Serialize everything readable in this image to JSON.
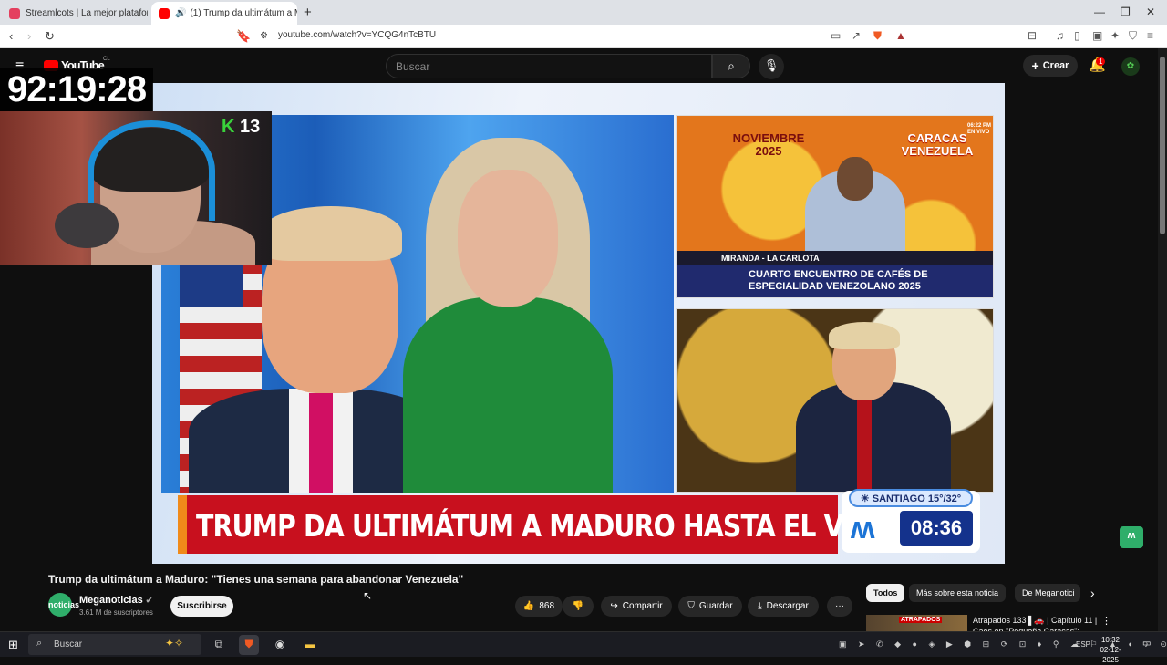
{
  "browser": {
    "tabs": [
      {
        "label": "Streamlcots | La mejor plataforma pa",
        "active": false,
        "favicon_color": "#e4405f"
      },
      {
        "label": "(1) Trump da ultimátum a Ma",
        "active": true,
        "favicon_color": "#ff0000"
      }
    ],
    "new_tab_symbol": "+",
    "url": "youtube.com/watch?v=YCQG4nTcBTU",
    "window_controls": {
      "minimize": "—",
      "maximize": "❐",
      "close": "✕"
    }
  },
  "youtube": {
    "logo": "YouTube",
    "country": "CL",
    "search_placeholder": "Buscar",
    "create_label": "Crear",
    "notifications_count": "1",
    "video": {
      "title": "Trump da ultimátum a Maduro: \"Tienes una semana para abandonar Venezuela\"",
      "channel": "Meganoticias",
      "channel_logo_text": "noticias",
      "subscribers": "3.61 M de suscriptores",
      "subscribe_label": "Suscribirse",
      "likes": "868",
      "share_label": "Compartir",
      "save_label": "Guardar",
      "download_label": "Descargar",
      "more_label": "···"
    },
    "chips": [
      {
        "label": "Todos",
        "selected": true
      },
      {
        "label": "Más sobre esta noticia",
        "selected": false
      },
      {
        "label": "De Meganotici",
        "selected": false
      }
    ],
    "suggested": {
      "thumb_text": "ATRAPADOS",
      "title": "Atrapados 133 ▌🚗 | Capítulo 11 | Caos en \"Pequeña Caracas\": ..."
    }
  },
  "broadcast": {
    "channel_bug": "13",
    "chyron": "TRUMP DA ULTIMÁTUM A MADURO HASTA EL VIERNES",
    "weather": "SANTIAGO 15°/32°",
    "time": "08:36",
    "top_panel": {
      "month": "NOVIEMBRE 2025",
      "city": "CARACAS VENEZUELA",
      "live_time": "06:22 PM EN VIVO",
      "location": "MIRANDA - LA CARLOTA",
      "banner": "CUARTO ENCUENTRO DE CAFÉS DE ESPECIALIDAD VENEZOLANO 2025"
    }
  },
  "stream_overlay": {
    "timer": "92:19:28"
  },
  "taskbar": {
    "search_placeholder": "Buscar",
    "language": "ESP",
    "time": "10:32",
    "date": "02-12-2025"
  }
}
